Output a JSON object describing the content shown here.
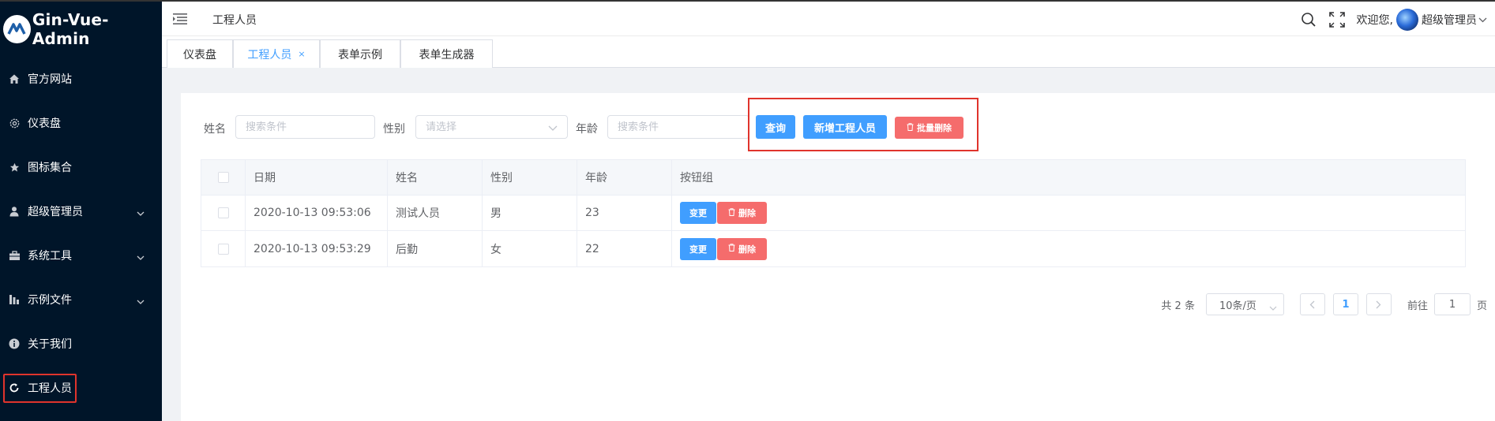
{
  "sidebar": {
    "logo_text": "Gin-Vue-Admin",
    "items": [
      {
        "label": "官方网站",
        "icon": "home-icon"
      },
      {
        "label": "仪表盘",
        "icon": "gear-icon"
      },
      {
        "label": "图标集合",
        "icon": "star-icon"
      },
      {
        "label": "超级管理员",
        "icon": "user-icon",
        "expandable": true
      },
      {
        "label": "系统工具",
        "icon": "toolbox-icon",
        "expandable": true
      },
      {
        "label": "示例文件",
        "icon": "chart-icon",
        "expandable": true
      },
      {
        "label": "关于我们",
        "icon": "info-icon"
      },
      {
        "label": "工程人员",
        "icon": "refresh-icon",
        "active": true
      }
    ]
  },
  "header": {
    "breadcrumb": "工程人员",
    "welcome": "欢迎您,",
    "user_name": "超级管理员"
  },
  "tabs": [
    {
      "label": "仪表盘"
    },
    {
      "label": "工程人员",
      "active": true,
      "close": "×"
    },
    {
      "label": "表单示例"
    },
    {
      "label": "表单生成器"
    }
  ],
  "search": {
    "name_label": "姓名",
    "name_placeholder": "搜索条件",
    "gender_label": "性别",
    "gender_placeholder": "请选择",
    "age_label": "年龄",
    "age_placeholder": "搜索条件",
    "query_button": "查询",
    "add_button": "新增工程人员",
    "batch_delete_button": "批量删除"
  },
  "table": {
    "columns": [
      "日期",
      "姓名",
      "性别",
      "年龄",
      "按钮组"
    ],
    "rows": [
      {
        "date": "2020-10-13 09:53:06",
        "name": "测试人员",
        "gender": "男",
        "age": "23",
        "edit": "变更",
        "delete": "删除"
      },
      {
        "date": "2020-10-13 09:53:29",
        "name": "后勤",
        "gender": "女",
        "age": "22",
        "edit": "变更",
        "delete": "删除"
      }
    ]
  },
  "pagination": {
    "total": "共 2 条",
    "page_size": "10条/页",
    "current_page": "1",
    "goto_label": "前往",
    "goto_value": "1",
    "page_suffix": "页"
  },
  "colors": {
    "sidebar_bg": "#001529",
    "primary": "#409eff",
    "danger": "#f56c6c",
    "highlight_border": "#e0342c"
  }
}
